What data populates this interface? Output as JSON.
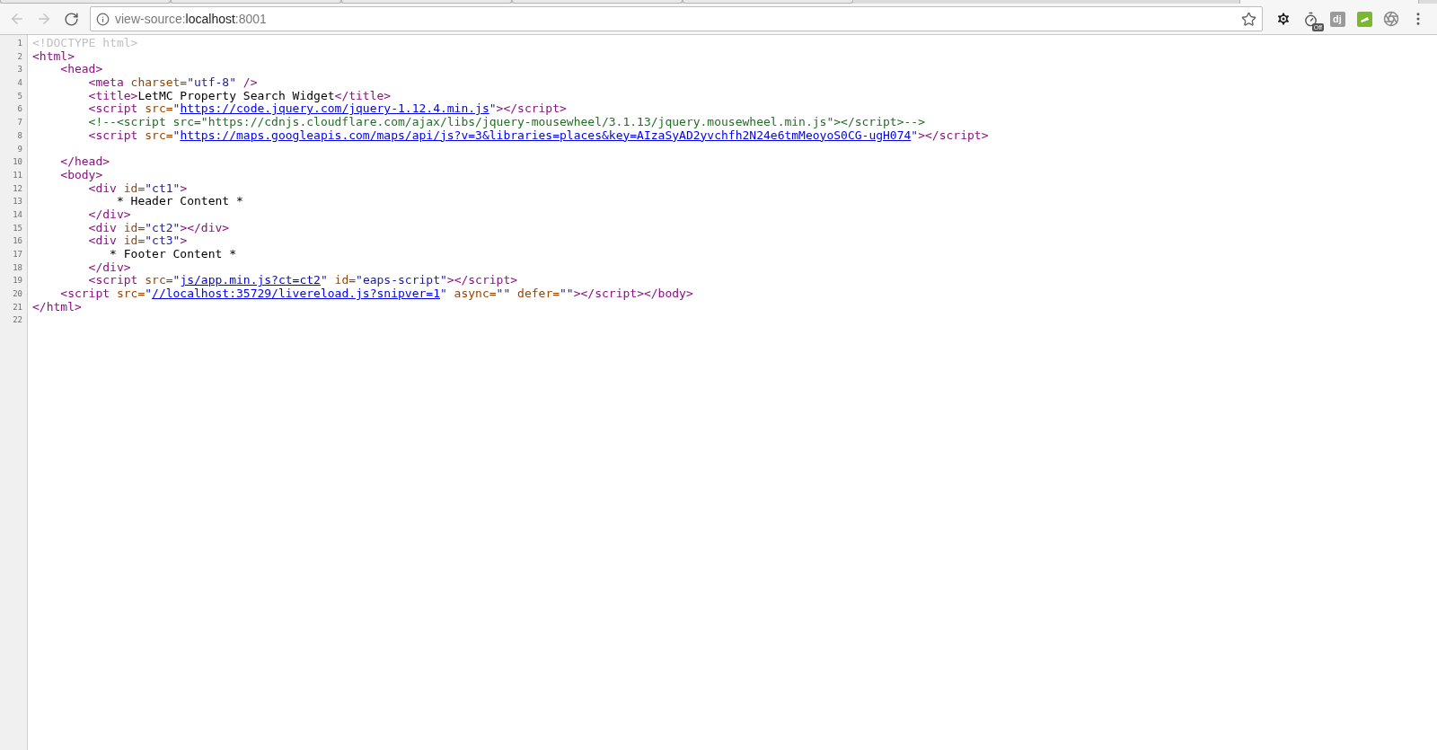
{
  "browser": {
    "address": {
      "scheme": "view-source:",
      "host": "localhost",
      "port": ":8001"
    },
    "timer_badge": "Off",
    "dj_logo": "dj"
  },
  "source": {
    "lines": [
      {
        "number": "1",
        "tokens": [
          {
            "kind": "doctype",
            "text": "<!DOCTYPE html>"
          }
        ]
      },
      {
        "number": "2",
        "tokens": [
          {
            "kind": "tag",
            "text": "<html>"
          }
        ]
      },
      {
        "number": "3",
        "tokens": [
          {
            "kind": "tag",
            "text": "    <head>"
          }
        ]
      },
      {
        "number": "4",
        "tokens": [
          {
            "kind": "tag",
            "text": "        <meta"
          },
          {
            "kind": "attr",
            "text": " charset="
          },
          {
            "kind": "value",
            "text": "\"utf-8\""
          },
          {
            "kind": "tag",
            "text": " />"
          }
        ]
      },
      {
        "number": "5",
        "tokens": [
          {
            "kind": "tag",
            "text": "        <title>"
          },
          {
            "kind": "text",
            "text": "LetMC Property Search Widget"
          },
          {
            "kind": "tag",
            "text": "</title>"
          }
        ]
      },
      {
        "number": "6",
        "tokens": [
          {
            "kind": "tag",
            "text": "        <script"
          },
          {
            "kind": "attr",
            "text": " src="
          },
          {
            "kind": "value",
            "text": "\""
          },
          {
            "kind": "link",
            "text": "https://code.jquery.com/jquery-1.12.4.min.js"
          },
          {
            "kind": "value",
            "text": "\""
          },
          {
            "kind": "tag",
            "text": "></script>"
          }
        ]
      },
      {
        "number": "7",
        "tokens": [
          {
            "kind": "comment",
            "text": "        <!--<script src=\"https://cdnjs.cloudflare.com/ajax/libs/jquery-mousewheel/3.1.13/jquery.mousewheel.min.js\"></script>-->"
          }
        ]
      },
      {
        "number": "8",
        "tokens": [
          {
            "kind": "tag",
            "text": "        <script"
          },
          {
            "kind": "attr",
            "text": " src="
          },
          {
            "kind": "value",
            "text": "\""
          },
          {
            "kind": "link",
            "text": "https://maps.googleapis.com/maps/api/js?v=3&libraries=places&key=AIzaSyAD2yvchfh2N24e6tmMeoyoS0CG-ugH074"
          },
          {
            "kind": "value",
            "text": "\""
          },
          {
            "kind": "tag",
            "text": "></script>"
          }
        ]
      },
      {
        "number": "9"
      },
      {
        "number": "10",
        "tokens": [
          {
            "kind": "tag",
            "text": "    </head>"
          }
        ]
      },
      {
        "number": "11",
        "tokens": [
          {
            "kind": "tag",
            "text": "    <body>"
          }
        ]
      },
      {
        "number": "12",
        "tokens": [
          {
            "kind": "tag",
            "text": "        <div"
          },
          {
            "kind": "attr",
            "text": " id="
          },
          {
            "kind": "value",
            "text": "\"ct1\""
          },
          {
            "kind": "tag",
            "text": ">"
          }
        ]
      },
      {
        "number": "13",
        "tokens": [
          {
            "kind": "text",
            "text": "            * Header Content *"
          }
        ]
      },
      {
        "number": "14",
        "tokens": [
          {
            "kind": "tag",
            "text": "        </div>"
          }
        ]
      },
      {
        "number": "15",
        "tokens": [
          {
            "kind": "tag",
            "text": "        <div"
          },
          {
            "kind": "attr",
            "text": " id="
          },
          {
            "kind": "value",
            "text": "\"ct2\""
          },
          {
            "kind": "tag",
            "text": "></div>"
          }
        ]
      },
      {
        "number": "16",
        "tokens": [
          {
            "kind": "tag",
            "text": "        <div"
          },
          {
            "kind": "attr",
            "text": " id="
          },
          {
            "kind": "value",
            "text": "\"ct3\""
          },
          {
            "kind": "tag",
            "text": ">"
          }
        ]
      },
      {
        "number": "17",
        "tokens": [
          {
            "kind": "text",
            "text": "           * Footer Content *"
          }
        ]
      },
      {
        "number": "18",
        "tokens": [
          {
            "kind": "tag",
            "text": "        </div>"
          }
        ]
      },
      {
        "number": "19",
        "tokens": [
          {
            "kind": "tag",
            "text": "        <script"
          },
          {
            "kind": "attr",
            "text": " src="
          },
          {
            "kind": "value",
            "text": "\""
          },
          {
            "kind": "link",
            "text": "js/app.min.js?ct=ct2"
          },
          {
            "kind": "value",
            "text": "\""
          },
          {
            "kind": "attr",
            "text": " id="
          },
          {
            "kind": "value",
            "text": "\"eaps-script\""
          },
          {
            "kind": "tag",
            "text": "></script>"
          }
        ]
      },
      {
        "number": "20",
        "tokens": [
          {
            "kind": "tag",
            "text": "    <script"
          },
          {
            "kind": "attr",
            "text": " src="
          },
          {
            "kind": "value",
            "text": "\""
          },
          {
            "kind": "link",
            "text": "//localhost:35729/livereload.js?snipver=1"
          },
          {
            "kind": "value",
            "text": "\""
          },
          {
            "kind": "attr",
            "text": " async="
          },
          {
            "kind": "value",
            "text": "\"\""
          },
          {
            "kind": "attr",
            "text": " defer="
          },
          {
            "kind": "value",
            "text": "\"\""
          },
          {
            "kind": "tag",
            "text": "></script></body>"
          }
        ]
      },
      {
        "number": "21",
        "tokens": [
          {
            "kind": "tag",
            "text": "</html>"
          }
        ]
      },
      {
        "number": "22"
      }
    ]
  }
}
